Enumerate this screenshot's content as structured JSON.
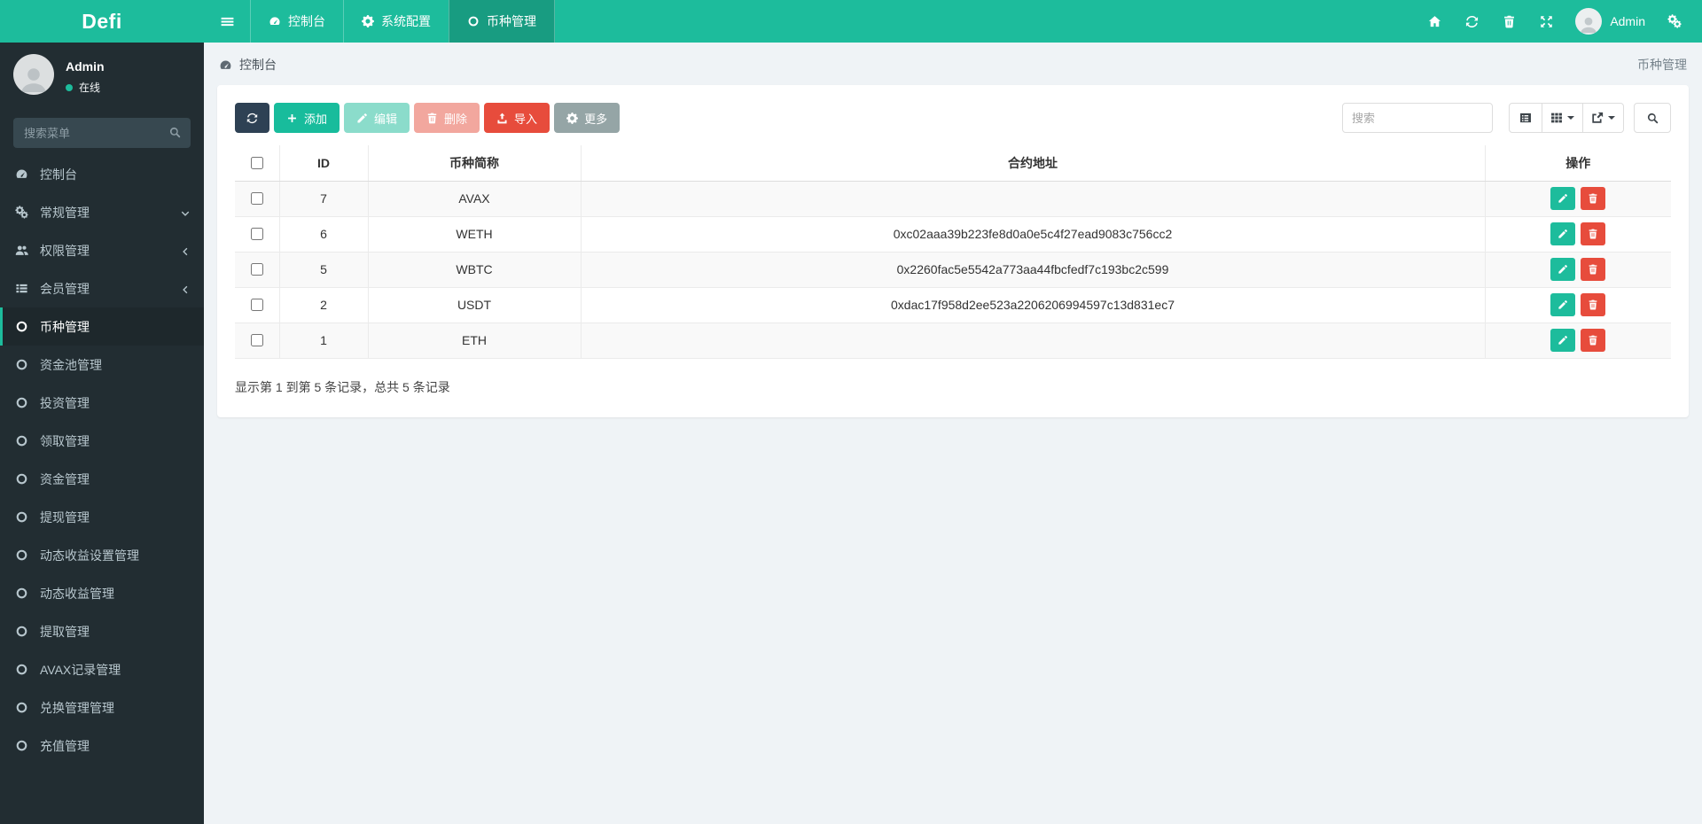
{
  "app": {
    "title": "Defi"
  },
  "navbar": {
    "tabs": [
      {
        "key": "dashboard",
        "label": "控制台",
        "icon": "dashboard",
        "active": false
      },
      {
        "key": "system-config",
        "label": "系统配置",
        "icon": "gear",
        "active": false
      },
      {
        "key": "coin-manage",
        "label": "币种管理",
        "icon": "circle",
        "active": true
      }
    ],
    "action_icons": [
      {
        "key": "home",
        "icon": "home"
      },
      {
        "key": "refresh",
        "icon": "refresh"
      },
      {
        "key": "trash",
        "icon": "trash"
      },
      {
        "key": "fullscreen",
        "icon": "expand"
      }
    ],
    "user": {
      "name": "Admin"
    },
    "settings_icon": "gears"
  },
  "sidebar": {
    "user": {
      "name": "Admin",
      "status": "在线"
    },
    "search_placeholder": "搜索菜单",
    "items": [
      {
        "key": "console",
        "label": "控制台",
        "icon": "dashboard",
        "chevron": "",
        "active": false
      },
      {
        "key": "general-manage",
        "label": "常规管理",
        "icon": "gears",
        "chevron": "down",
        "active": false
      },
      {
        "key": "permission-manage",
        "label": "权限管理",
        "icon": "users",
        "chevron": "left",
        "active": false
      },
      {
        "key": "member-manage",
        "label": "会员管理",
        "icon": "list",
        "chevron": "left",
        "active": false
      },
      {
        "key": "coin-manage",
        "label": "币种管理",
        "icon": "circle",
        "chevron": "",
        "active": true
      },
      {
        "key": "pool-manage",
        "label": "资金池管理",
        "icon": "circle",
        "chevron": "",
        "active": false
      },
      {
        "key": "invest-manage",
        "label": "投资管理",
        "icon": "circle",
        "chevron": "",
        "active": false
      },
      {
        "key": "claim-manage",
        "label": "领取管理",
        "icon": "circle",
        "chevron": "",
        "active": false
      },
      {
        "key": "funds-manage",
        "label": "资金管理",
        "icon": "circle",
        "chevron": "",
        "active": false
      },
      {
        "key": "withdraw-manage",
        "label": "提现管理",
        "icon": "circle",
        "chevron": "",
        "active": false
      },
      {
        "key": "dynamic-income-settings",
        "label": "动态收益设置管理",
        "icon": "circle",
        "chevron": "",
        "active": false
      },
      {
        "key": "dynamic-income-manage",
        "label": "动态收益管理",
        "icon": "circle",
        "chevron": "",
        "active": false
      },
      {
        "key": "extract-manage",
        "label": "提取管理",
        "icon": "circle",
        "chevron": "",
        "active": false
      },
      {
        "key": "avax-records-manage",
        "label": "AVAX记录管理",
        "icon": "circle",
        "chevron": "",
        "active": false
      },
      {
        "key": "exchange-manage",
        "label": "兑换管理管理",
        "icon": "circle",
        "chevron": "",
        "active": false
      },
      {
        "key": "recharge-manage",
        "label": "充值管理",
        "icon": "circle",
        "chevron": "",
        "active": false
      }
    ]
  },
  "breadcrumb": {
    "location": "控制台",
    "page_title": "币种管理"
  },
  "toolbar": {
    "buttons": [
      {
        "key": "refresh",
        "label": "",
        "icon": "refresh",
        "style": "dark",
        "disabled": false
      },
      {
        "key": "add",
        "label": "添加",
        "icon": "plus",
        "style": "green",
        "disabled": false
      },
      {
        "key": "edit",
        "label": "编辑",
        "icon": "pencil",
        "style": "green",
        "disabled": true
      },
      {
        "key": "delete",
        "label": "删除",
        "icon": "trash",
        "style": "red",
        "disabled": true
      },
      {
        "key": "import",
        "label": "导入",
        "icon": "upload",
        "style": "red",
        "disabled": false
      },
      {
        "key": "more",
        "label": "更多",
        "icon": "gear",
        "style": "gray",
        "disabled": false
      }
    ],
    "search_placeholder": "搜索",
    "view_buttons": [
      {
        "key": "toggle-view",
        "icon": "listalt",
        "caret": false
      },
      {
        "key": "columns",
        "icon": "columns",
        "caret": true
      },
      {
        "key": "export",
        "icon": "export",
        "caret": true
      }
    ],
    "search_button_icon": "search"
  },
  "table": {
    "columns": [
      "ID",
      "币种简称",
      "合约地址",
      "操作"
    ],
    "rows": [
      {
        "id": "7",
        "symbol": "AVAX",
        "address": ""
      },
      {
        "id": "6",
        "symbol": "WETH",
        "address": "0xc02aaa39b223fe8d0a0e5c4f27ead9083c756cc2"
      },
      {
        "id": "5",
        "symbol": "WBTC",
        "address": "0x2260fac5e5542a773aa44fbcfedf7c193bc2c599"
      },
      {
        "id": "2",
        "symbol": "USDT",
        "address": "0xdac17f958d2ee523a2206206994597c13d831ec7"
      },
      {
        "id": "1",
        "symbol": "ETH",
        "address": ""
      }
    ],
    "summary": "显示第 1 到第 5 条记录，总共 5 条记录"
  },
  "theme": {
    "accent": "#1dbc9c",
    "danger": "#e74c3c",
    "dark_button": "#2e4154",
    "gray_button": "#95a5a6",
    "sidebar_bg": "#222d32",
    "sidebar_active_bg": "#1e282c",
    "content_bg": "#eff3f6",
    "stripe_row": "#f9f9f9"
  }
}
